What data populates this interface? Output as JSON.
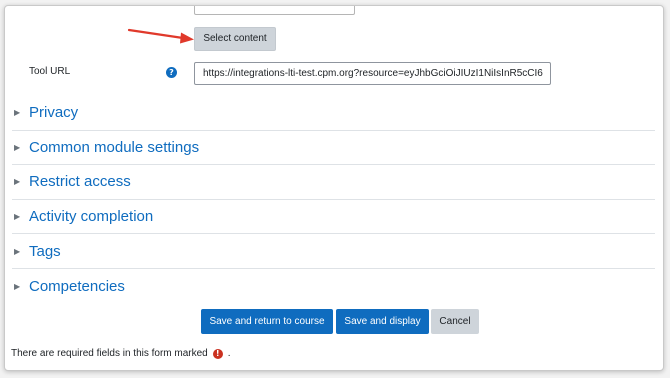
{
  "form": {
    "select_content_label": "Select content",
    "tool_url_label": "Tool URL",
    "help_glyph": "?",
    "tool_url_value": "https://integrations-lti-test.cpm.org?resource=eyJhbGciOiJIUzI1NiIsInR5cCI6"
  },
  "sections": [
    {
      "title": "Privacy",
      "icon": "chevron-right-icon"
    },
    {
      "title": "Common module settings",
      "icon": "chevron-right-icon"
    },
    {
      "title": "Restrict access",
      "icon": "chevron-right-icon"
    },
    {
      "title": "Activity completion",
      "icon": "chevron-right-icon"
    },
    {
      "title": "Tags",
      "icon": "chevron-right-icon"
    },
    {
      "title": "Competencies",
      "icon": "chevron-right-icon"
    }
  ],
  "actions": {
    "save_return": "Save and return to course",
    "save_display": "Save and display",
    "cancel": "Cancel"
  },
  "footer": {
    "required_text": "There are required fields in this form marked",
    "required_glyph": "!",
    "trailing": "."
  },
  "colors": {
    "primary": "#0f6cbf",
    "secondary": "#ced4da",
    "required": "#ca3120",
    "annotation_arrow": "#e0392b"
  }
}
